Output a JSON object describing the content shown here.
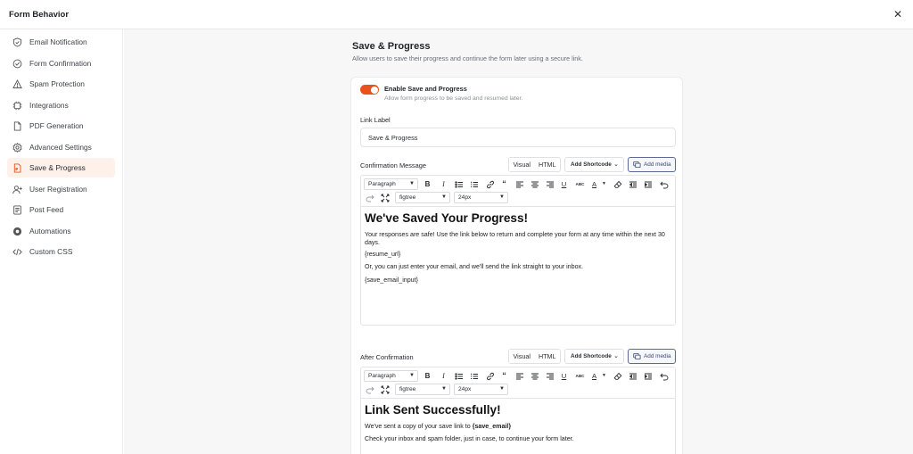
{
  "window": {
    "title": "Form Behavior",
    "close_icon": "close-icon"
  },
  "colors": {
    "accent": "#e8531c",
    "active_bg": "#fdf1ea",
    "media_border": "#5a6a94"
  },
  "sidebar": {
    "items": [
      {
        "label": "Email Notification",
        "icon": "shield-icon"
      },
      {
        "label": "Form Confirmation",
        "icon": "check-circle-icon"
      },
      {
        "label": "Spam Protection",
        "icon": "warning-icon"
      },
      {
        "label": "Integrations",
        "icon": "integrations-icon"
      },
      {
        "label": "PDF Generation",
        "icon": "document-icon"
      },
      {
        "label": "Advanced Settings",
        "icon": "gear-icon"
      },
      {
        "label": "Save & Progress",
        "icon": "save-document-icon",
        "active": true
      },
      {
        "label": "User Registration",
        "icon": "user-plus-icon"
      },
      {
        "label": "Post Feed",
        "icon": "post-icon"
      },
      {
        "label": "Automations",
        "icon": "automations-icon"
      },
      {
        "label": "Custom CSS",
        "icon": "code-icon"
      }
    ]
  },
  "section": {
    "title": "Save & Progress",
    "description": "Allow users to save their progress and continue the form later using a secure link."
  },
  "toggle": {
    "label": "Enable Save and Progress",
    "description": "Allow form progress to be saved and resumed later.",
    "enabled": true
  },
  "link_label": {
    "label": "Link Label",
    "value": "Save & Progress"
  },
  "editor_controls": {
    "visual": "Visual",
    "html": "HTML",
    "add_shortcode": "Add Shortcode",
    "add_media": "Add media",
    "format": "Paragraph",
    "font": "figtree",
    "size": "24px"
  },
  "confirmation_message": {
    "label": "Confirmation Message",
    "heading": "We've Saved Your Progress!",
    "paragraphs": [
      "Your responses are safe! Use the link below to return and complete your form at any time within the next 30 days.",
      "{resume_url}",
      "Or, you can just enter your email, and we'll send the link straight to your inbox.",
      "{save_email_input}"
    ]
  },
  "after_confirmation": {
    "label": "After Confirmation",
    "heading": "Link Sent Successfully!",
    "line1_prefix": "We've sent a copy of your save link to ",
    "line1_bold": "{save_email}",
    "line2": "Check your inbox and spam folder, just in case, to continue your form later."
  }
}
